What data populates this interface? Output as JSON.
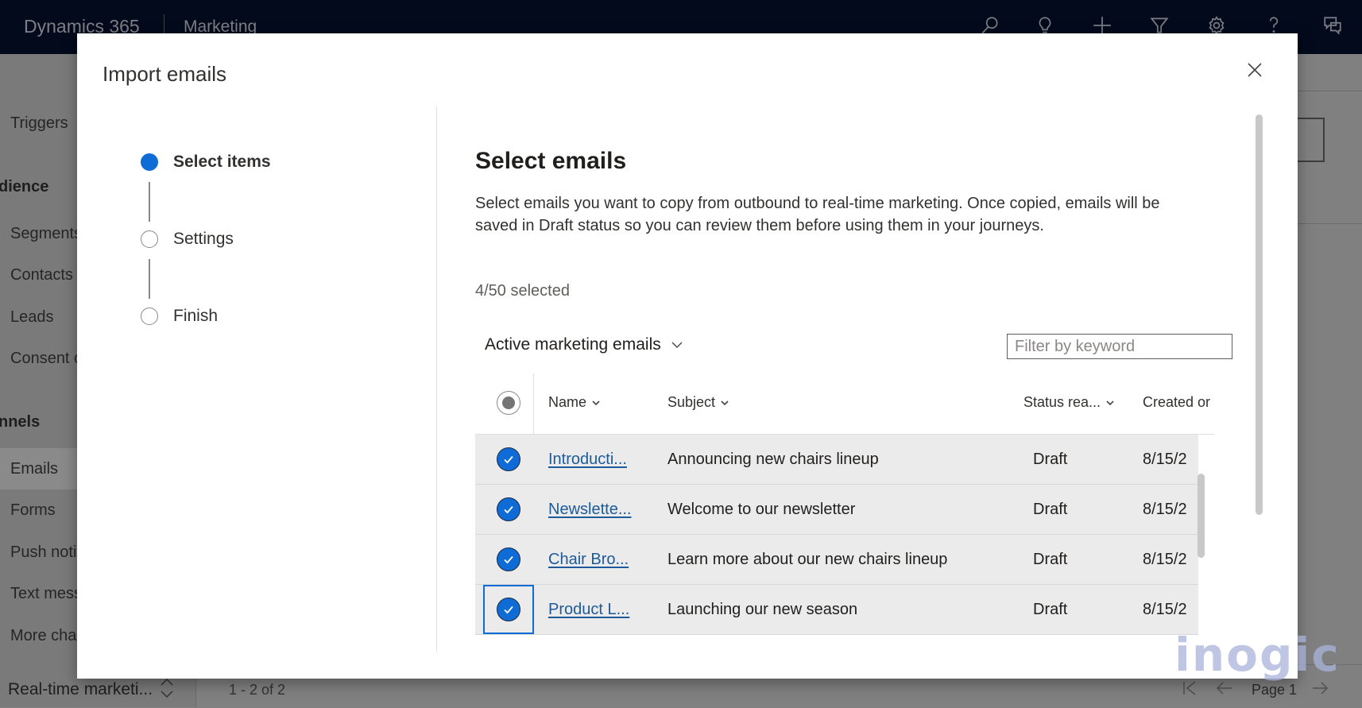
{
  "topbar": {
    "brand": "Dynamics 365",
    "app_name": "Marketing",
    "icons": [
      "search-icon",
      "lightbulb-icon",
      "plus-icon",
      "filter-icon",
      "gear-icon",
      "help-icon",
      "chat-icon"
    ]
  },
  "background_sidebar": {
    "items": [
      {
        "label": "Triggers",
        "type": "item"
      },
      {
        "label": "dience",
        "type": "group"
      },
      {
        "label": "Segments",
        "type": "item"
      },
      {
        "label": "Contacts",
        "type": "item"
      },
      {
        "label": "Leads",
        "type": "item"
      },
      {
        "label": "Consent c",
        "type": "item"
      },
      {
        "label": "nnels",
        "type": "group"
      },
      {
        "label": "Emails",
        "type": "item",
        "active": true
      },
      {
        "label": "Forms",
        "type": "item"
      },
      {
        "label": "Push noti",
        "type": "item"
      },
      {
        "label": "Text mess",
        "type": "item"
      },
      {
        "label": "More cha",
        "type": "item"
      }
    ],
    "view_switcher": "Real-time marketi..."
  },
  "background_footer": {
    "record_count": "1 - 2 of 2",
    "page_label": "Page 1"
  },
  "dialog": {
    "title": "Import emails",
    "close_label": "Close",
    "steps": [
      {
        "label": "Select items",
        "active": true
      },
      {
        "label": "Settings",
        "active": false
      },
      {
        "label": "Finish",
        "active": false
      }
    ],
    "heading": "Select emails",
    "description": "Select emails you want to copy from outbound to real-time marketing. Once copied, emails will be saved in Draft status so you can review them before using them in your journeys.",
    "selected_count": "4/50 selected",
    "view_selector": "Active marketing emails",
    "filter": {
      "placeholder": "Filter by keyword",
      "value": ""
    },
    "table": {
      "columns": [
        "Name",
        "Subject",
        "Status rea...",
        "Created or"
      ],
      "rows": [
        {
          "name": "Introducti...",
          "subject": "Announcing new chairs lineup",
          "status": "Draft",
          "created": "8/15/2",
          "selected": true
        },
        {
          "name": "Newslette...",
          "subject": "Welcome to our newsletter",
          "status": "Draft",
          "created": "8/15/2",
          "selected": true
        },
        {
          "name": "Chair Bro...",
          "subject": "Learn more about our new chairs lineup",
          "status": "Draft",
          "created": "8/15/2",
          "selected": true
        },
        {
          "name": "Product L...",
          "subject": "Launching our new season",
          "status": "Draft",
          "created": "8/15/2",
          "selected": true,
          "focused": true
        }
      ]
    }
  },
  "watermark": "inogic",
  "colors": {
    "topbar_bg": "#020a1c",
    "accent": "#0f6cd6",
    "link": "#1d5a9a",
    "row_selected_bg": "#ebebeb",
    "overlay": "#808080"
  }
}
